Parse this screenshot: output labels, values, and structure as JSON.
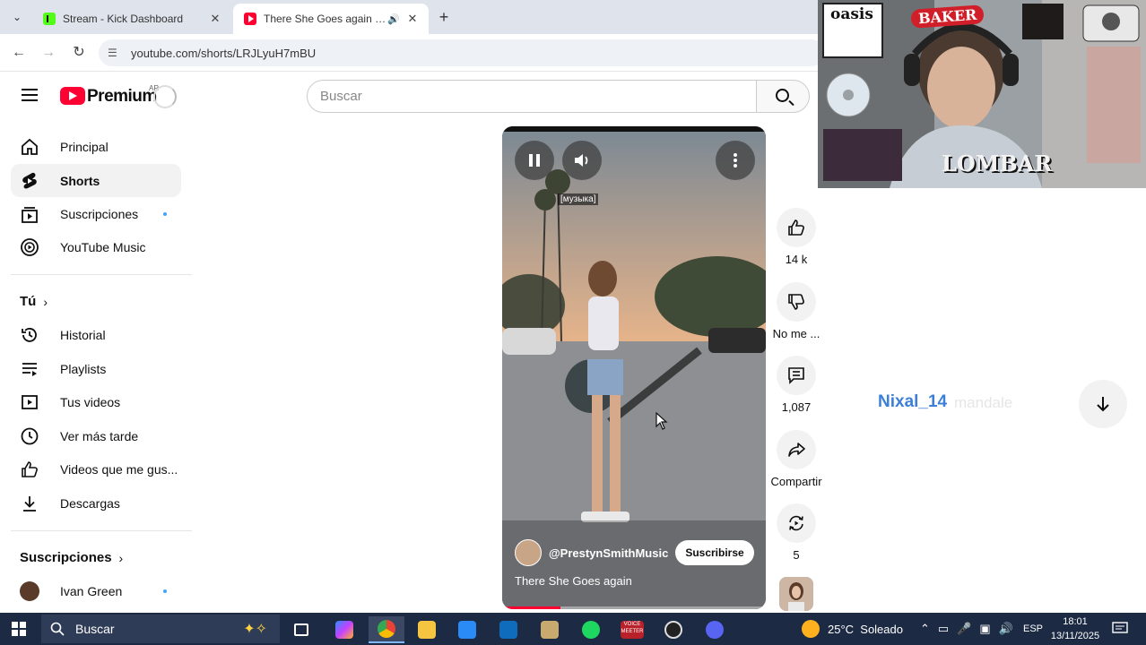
{
  "browser": {
    "tabs": [
      {
        "title": "Stream - Kick Dashboard"
      },
      {
        "title": "There She Goes again - You"
      }
    ],
    "url": "youtube.com/shorts/LRJLyuH7mBU"
  },
  "youtube": {
    "brand": "Premium",
    "country": "AR",
    "search_placeholder": "Buscar"
  },
  "sidebar": {
    "main_items": [
      {
        "label": "Principal"
      },
      {
        "label": "Shorts"
      },
      {
        "label": "Suscripciones"
      },
      {
        "label": "YouTube Music"
      }
    ],
    "you_heading": "Tú",
    "you_items": [
      {
        "label": "Historial"
      },
      {
        "label": "Playlists"
      },
      {
        "label": "Tus videos"
      },
      {
        "label": "Ver más tarde"
      },
      {
        "label": "Videos que me gus..."
      },
      {
        "label": "Descargas"
      }
    ],
    "subs_heading": "Suscripciones",
    "subs_items": [
      {
        "label": "Ivan Green"
      }
    ]
  },
  "short": {
    "caption_tag": "[музыка]",
    "channel": "@PrestynSmithMusic",
    "subscribe_label": "Suscribirse",
    "title": "There She Goes again",
    "progress": 0.22
  },
  "actions": {
    "likes": "14 k",
    "dislike": "No me ...",
    "comments": "1,087",
    "share": "Compartir",
    "remix": "5"
  },
  "overlay": {
    "stickers": [
      "oasis",
      "BAKER",
      "LOMBAR"
    ],
    "chat_user": "Nixal_14",
    "chat_message": "mandale"
  },
  "taskbar": {
    "search": "Buscar",
    "weather": "25°C  Soleado",
    "lang": "ESP",
    "time": "18:01",
    "date": "13/11/2025",
    "voicemeeter": "VOICE MEETER"
  },
  "colors": {
    "youtube_red": "#ff0033",
    "chat_user": "#3b7fd6",
    "taskbar": "#1c2a44"
  }
}
